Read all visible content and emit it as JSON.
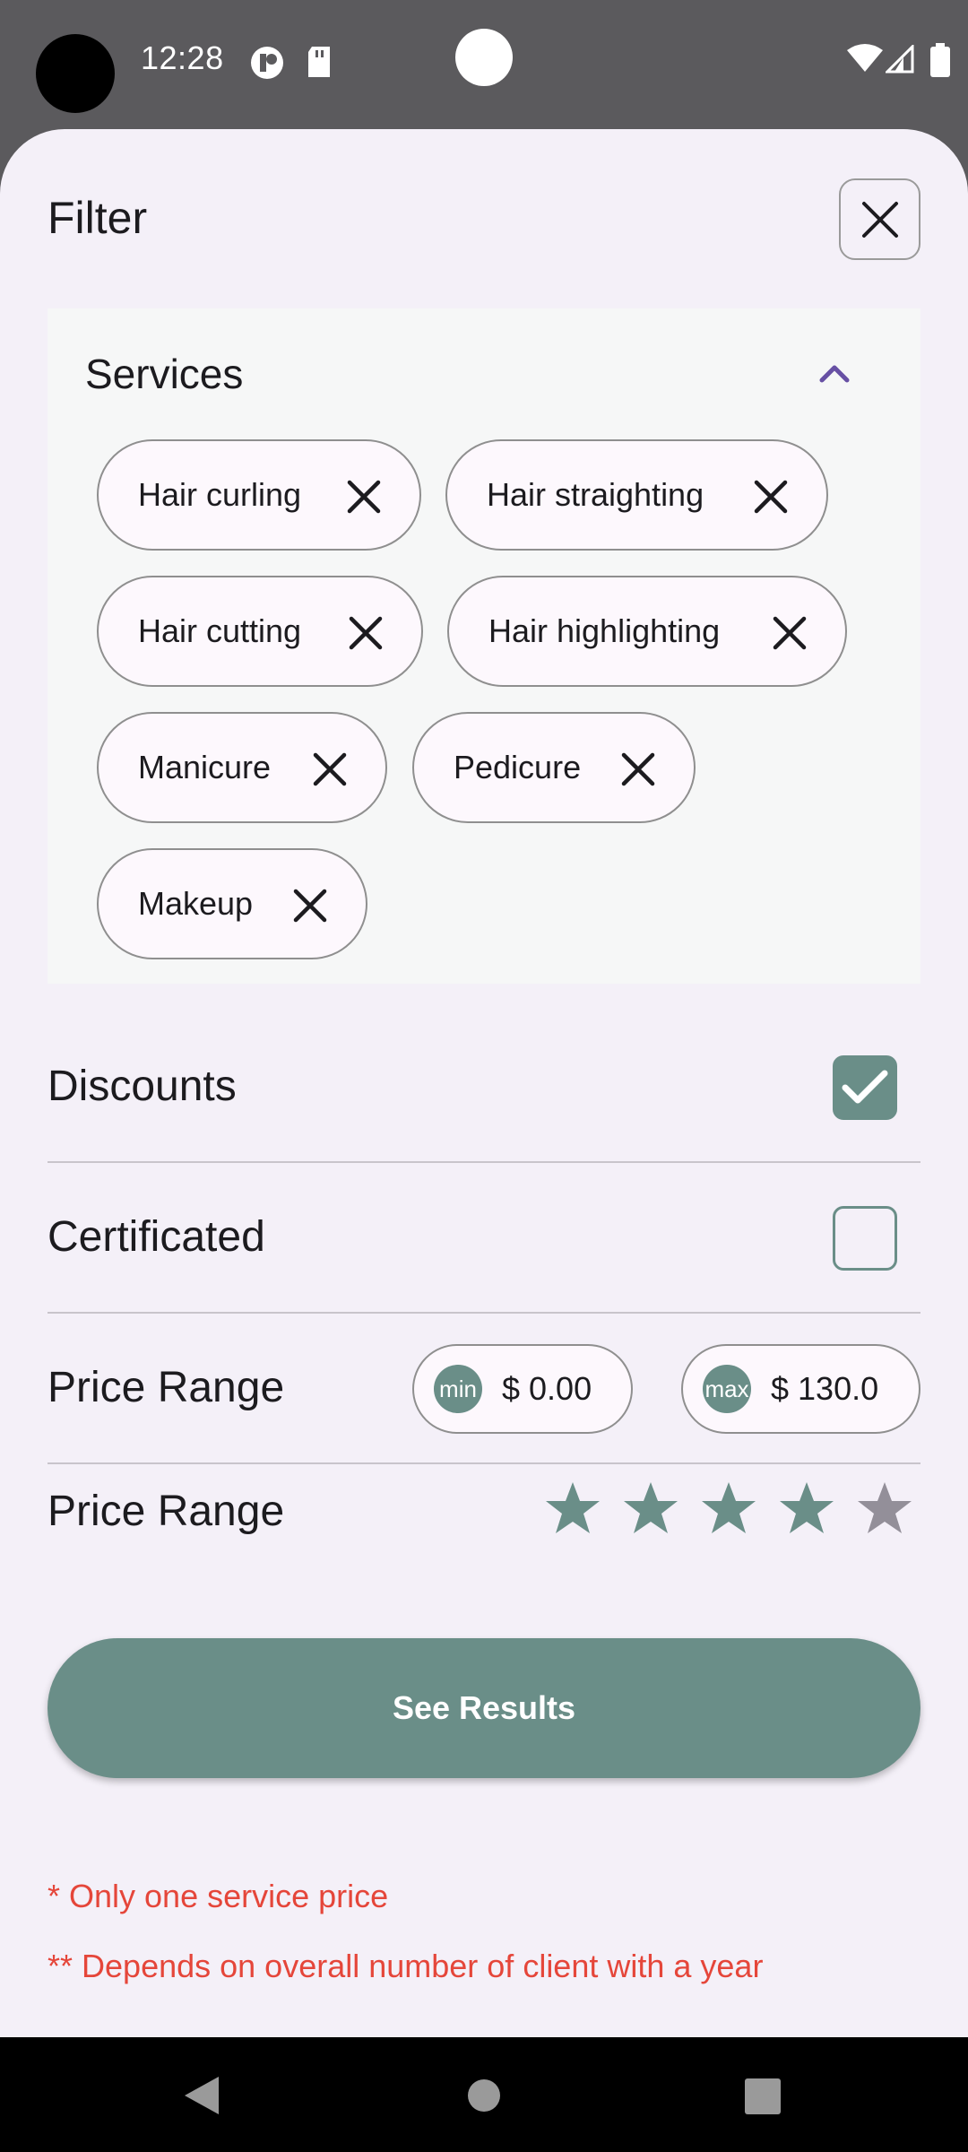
{
  "status_bar": {
    "time": "12:28",
    "icons": [
      "sync-icon",
      "sd-card-icon",
      "wifi-icon",
      "signal-icon",
      "battery-icon"
    ]
  },
  "header": {
    "title": "Filter",
    "close_icon": "close-icon"
  },
  "services": {
    "title": "Services",
    "expanded": true,
    "chips": [
      {
        "label": "Hair curling"
      },
      {
        "label": "Hair straighting"
      },
      {
        "label": "Hair cutting"
      },
      {
        "label": "Hair highlighting"
      },
      {
        "label": "Manicure"
      },
      {
        "label": "Pedicure"
      },
      {
        "label": "Makeup"
      }
    ]
  },
  "discounts": {
    "label": "Discounts",
    "checked": true
  },
  "certificated": {
    "label": "Certificated",
    "checked": false
  },
  "price_range": {
    "label": "Price Range",
    "min_badge": "min",
    "min_value": "$ 0.00",
    "max_badge": "max",
    "max_value": "$ 130.0"
  },
  "rating": {
    "label": "Price Range",
    "value": 4,
    "max": 5
  },
  "cta": {
    "label": "See Results"
  },
  "notes": {
    "note1": "* Only one service price",
    "note2": "** Depends on overall number of client with a year"
  },
  "colors": {
    "accent": "#6a8e88",
    "sheet_bg": "#f4f0f8",
    "note_red": "#e5463a",
    "chevron_purple": "#6750a4",
    "star_inactive": "#938f99"
  }
}
